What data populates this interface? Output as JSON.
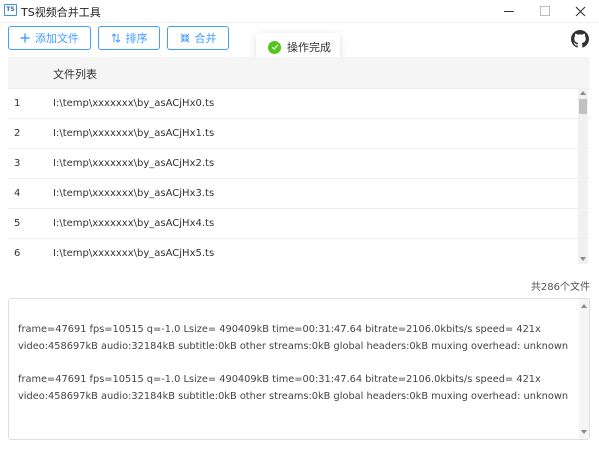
{
  "window": {
    "title": "TS视频合并工具",
    "icon_text": "TS"
  },
  "toolbar": {
    "add_label": "添加文件",
    "sort_label": "排序",
    "merge_label": "合并",
    "accent_color": "#409eff"
  },
  "toast": {
    "message": "操作完成",
    "icon": "check-circle-icon",
    "color": "#52c41a"
  },
  "table": {
    "header": "文件列表",
    "rows": [
      {
        "index": "1",
        "path": "I:\\temp\\xxxxxxx\\by_asACjHx0.ts"
      },
      {
        "index": "2",
        "path": "I:\\temp\\xxxxxxx\\by_asACjHx1.ts"
      },
      {
        "index": "3",
        "path": "I:\\temp\\xxxxxxx\\by_asACjHx2.ts"
      },
      {
        "index": "4",
        "path": "I:\\temp\\xxxxxxx\\by_asACjHx3.ts"
      },
      {
        "index": "5",
        "path": "I:\\temp\\xxxxxxx\\by_asACjHx4.ts"
      },
      {
        "index": "6",
        "path": "I:\\temp\\xxxxxxx\\by_asACjHx5.ts"
      }
    ]
  },
  "summary": {
    "count_text": "共286个文件"
  },
  "log": {
    "lines": [
      "frame=47691 fps=10515 q=-1.0 Lsize=  490409kB time=00:31:47.64 bitrate=2106.0kbits/s speed= 421x",
      "video:458697kB audio:32184kB subtitle:0kB other streams:0kB global headers:0kB muxing overhead: unknown",
      "frame=47691 fps=10515 q=-1.0 Lsize=  490409kB time=00:31:47.64 bitrate=2106.0kbits/s speed= 421x",
      "video:458697kB audio:32184kB subtitle:0kB other streams:0kB global headers:0kB muxing overhead: unknown"
    ]
  }
}
